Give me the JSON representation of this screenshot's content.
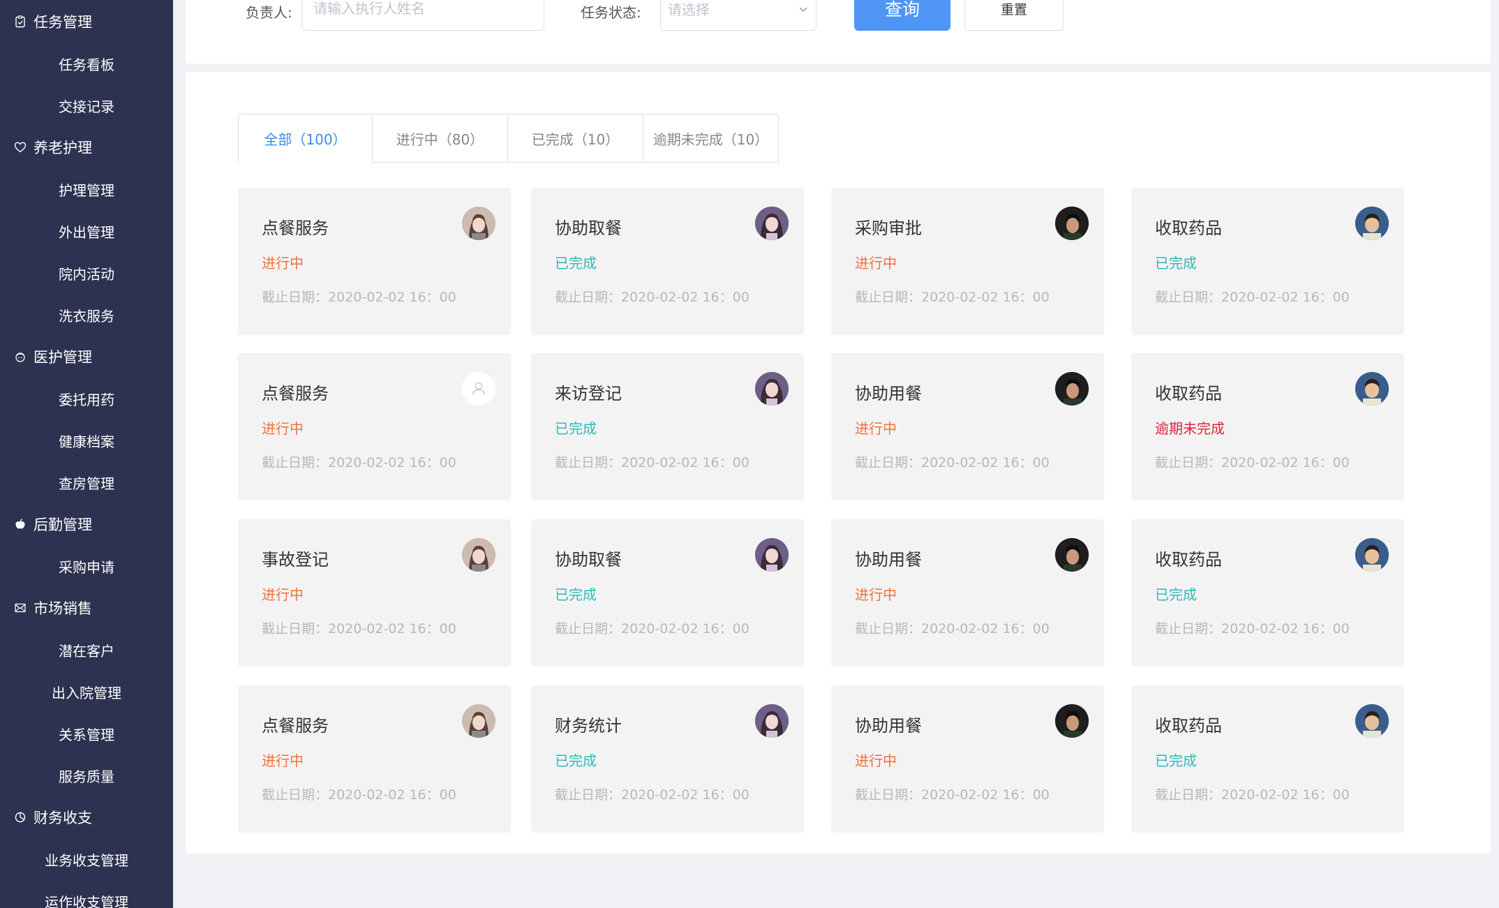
{
  "sidebar": {
    "groups": [
      {
        "title": "任务管理",
        "icon": "clipboard-check-icon",
        "items": [
          "任务看板",
          "交接记录"
        ]
      },
      {
        "title": "养老护理",
        "icon": "heart-icon",
        "items": [
          "护理管理",
          "外出管理",
          "院内活动",
          "洗衣服务"
        ]
      },
      {
        "title": "医护管理",
        "icon": "nurse-icon",
        "items": [
          "委托用药",
          "健康档案",
          "查房管理"
        ]
      },
      {
        "title": "后勤管理",
        "icon": "apple-icon",
        "items": [
          "采购申请"
        ]
      },
      {
        "title": "市场销售",
        "icon": "mail-icon",
        "items": [
          "潜在客户",
          "出入院管理",
          "关系管理",
          "服务质量"
        ]
      },
      {
        "title": "财务收支",
        "icon": "pie-chart-icon",
        "items": [
          "业务收支管理",
          "运作收支管理"
        ]
      }
    ]
  },
  "filters": {
    "owner_label": "负责人:",
    "owner_placeholder": "请输入执行人姓名",
    "status_label": "任务状态:",
    "status_placeholder": "请选择",
    "query_button": "查询",
    "reset_button": "重置"
  },
  "tabs": [
    {
      "label": "全部（100）",
      "active": true
    },
    {
      "label": "进行中（80）",
      "active": false
    },
    {
      "label": "已完成（10）",
      "active": false
    },
    {
      "label": "逾期未完成（10）",
      "active": false
    }
  ],
  "colors": {
    "sidebar_bg": "#2c3250",
    "primary": "#4f95f5",
    "status_ongoing": "#f5703a",
    "status_done": "#2bbbb8",
    "status_overdue": "#e3203a"
  },
  "cards": [
    {
      "title": "点餐服务",
      "status": "进行中",
      "status_type": "ongoing",
      "deadline": "截止日期：2020-02-02 16：00",
      "avatar": "woman-avatar-1"
    },
    {
      "title": "协助取餐",
      "status": "已完成",
      "status_type": "done",
      "deadline": "截止日期：2020-02-02 16：00",
      "avatar": "woman-avatar-2"
    },
    {
      "title": "采购审批",
      "status": "进行中",
      "status_type": "ongoing",
      "deadline": "截止日期：2020-02-02 16：00",
      "avatar": "man-avatar-1"
    },
    {
      "title": "收取药品",
      "status": "已完成",
      "status_type": "done",
      "deadline": "截止日期：2020-02-02 16：00",
      "avatar": "man-avatar-2"
    },
    {
      "title": "点餐服务",
      "status": "进行中",
      "status_type": "ongoing",
      "deadline": "截止日期：2020-02-02 16：00",
      "avatar": "default-user-avatar"
    },
    {
      "title": "来访登记",
      "status": "已完成",
      "status_type": "done",
      "deadline": "截止日期：2020-02-02 16：00",
      "avatar": "woman-avatar-2"
    },
    {
      "title": "协助用餐",
      "status": "进行中",
      "status_type": "ongoing",
      "deadline": "截止日期：2020-02-02 16：00",
      "avatar": "man-avatar-1"
    },
    {
      "title": "收取药品",
      "status": "逾期未完成",
      "status_type": "overdue",
      "deadline": "截止日期：2020-02-02 16：00",
      "avatar": "man-avatar-2"
    },
    {
      "title": "事故登记",
      "status": "进行中",
      "status_type": "ongoing",
      "deadline": "截止日期：2020-02-02 16：00",
      "avatar": "woman-avatar-1"
    },
    {
      "title": "协助取餐",
      "status": "已完成",
      "status_type": "done",
      "deadline": "截止日期：2020-02-02 16：00",
      "avatar": "woman-avatar-2"
    },
    {
      "title": "协助用餐",
      "status": "进行中",
      "status_type": "ongoing",
      "deadline": "截止日期：2020-02-02 16：00",
      "avatar": "man-avatar-1"
    },
    {
      "title": "收取药品",
      "status": "已完成",
      "status_type": "done",
      "deadline": "截止日期：2020-02-02 16：00",
      "avatar": "man-avatar-2"
    },
    {
      "title": "点餐服务",
      "status": "进行中",
      "status_type": "ongoing",
      "deadline": "截止日期：2020-02-02 16：00",
      "avatar": "woman-avatar-1"
    },
    {
      "title": "财务统计",
      "status": "已完成",
      "status_type": "done",
      "deadline": "截止日期：2020-02-02 16：00",
      "avatar": "woman-avatar-2"
    },
    {
      "title": "协助用餐",
      "status": "进行中",
      "status_type": "ongoing",
      "deadline": "截止日期：2020-02-02 16：00",
      "avatar": "man-avatar-1"
    },
    {
      "title": "收取药品",
      "status": "已完成",
      "status_type": "done",
      "deadline": "截止日期：2020-02-02 16：00",
      "avatar": "man-avatar-2"
    }
  ]
}
